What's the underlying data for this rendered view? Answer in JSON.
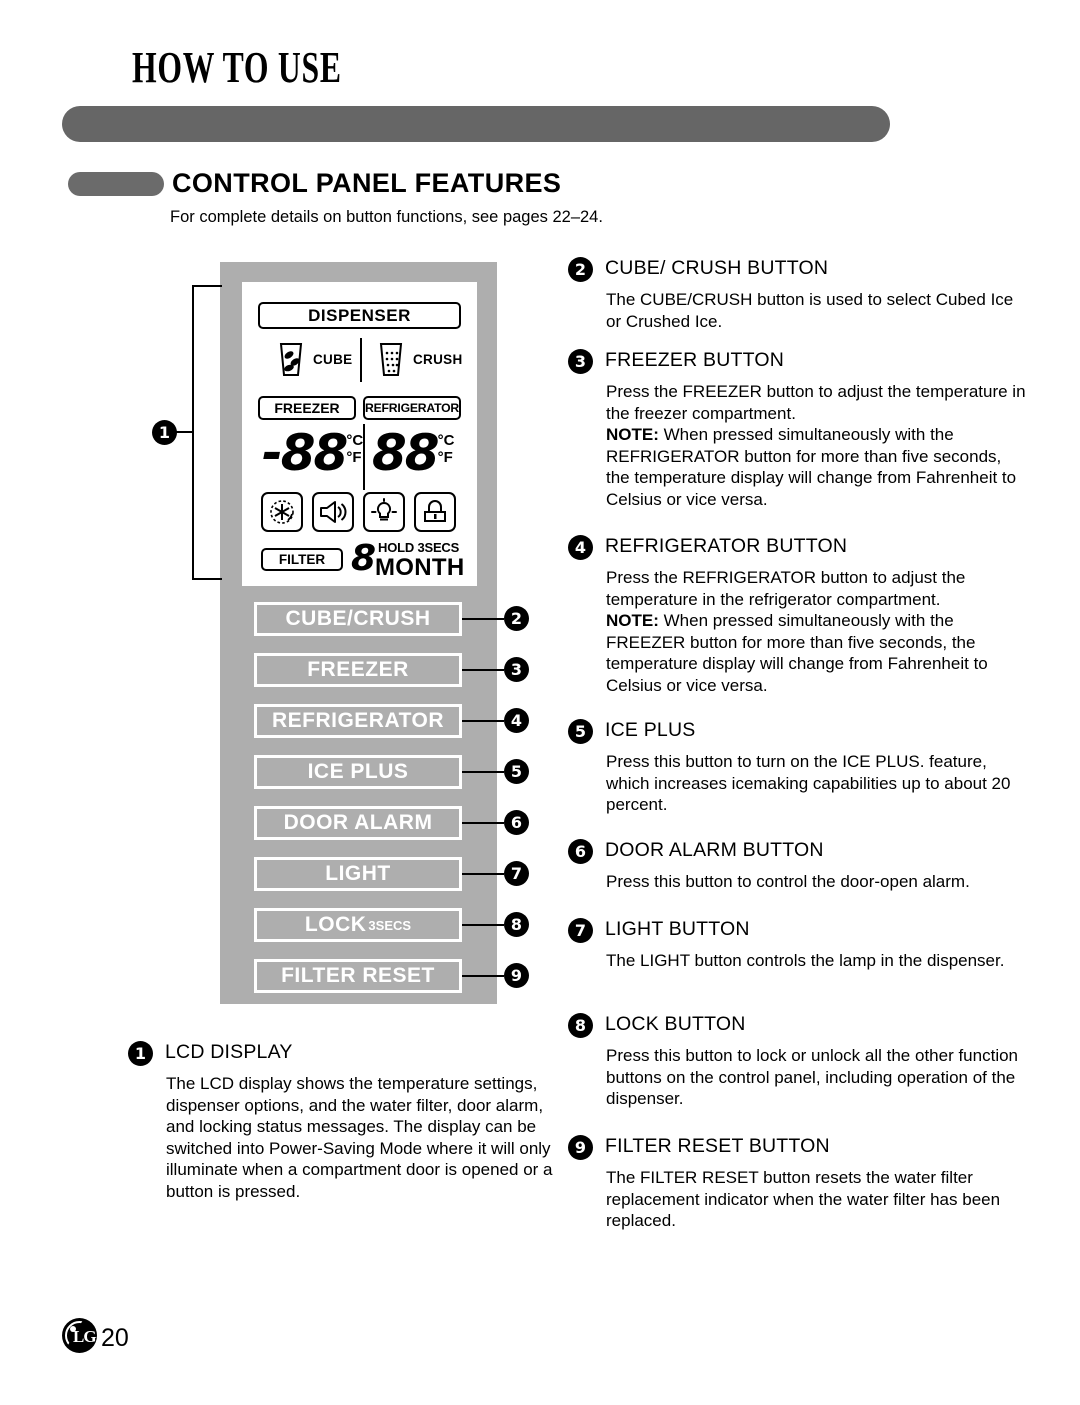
{
  "page": {
    "title": "HOW TO USE",
    "section_title": "CONTROL PANEL FEATURES",
    "section_subtitle": "For complete details on button functions, see pages 22–24.",
    "page_number": "20",
    "brand": "LG"
  },
  "lcd": {
    "dispenser_label": "DISPENSER",
    "cube_label": "CUBE",
    "crush_label": "CRUSH",
    "freezer_label": "FREEZER",
    "refrigerator_label": "REFRIGERATOR",
    "freezer_digits": "-88",
    "refrigerator_digits": "88",
    "unit_c": "°C",
    "unit_f": "°F",
    "filter_label": "FILTER",
    "month_digit": "8",
    "hold_secs": "HOLD 3SECS",
    "month_word": "MONTH",
    "icons": [
      "ice-plus-icon",
      "door-alarm-speaker-icon",
      "light-bulb-icon",
      "lock-icon"
    ]
  },
  "panel_buttons": [
    {
      "label": "CUBE/CRUSH",
      "callout": "2"
    },
    {
      "label": "FREEZER",
      "callout": "3"
    },
    {
      "label": "REFRIGERATOR",
      "callout": "4"
    },
    {
      "label": "ICE PLUS",
      "callout": "5"
    },
    {
      "label": "DOOR ALARM",
      "callout": "6"
    },
    {
      "label": "LIGHT",
      "callout": "7",
      "suffix": ""
    },
    {
      "label": "LOCK",
      "callout": "8",
      "suffix": "3SECS"
    },
    {
      "label": "FILTER RESET",
      "callout": "9"
    }
  ],
  "lcd_callout": "1",
  "entries": {
    "e1": {
      "num": "1",
      "head": "LCD DISPLAY",
      "body": "The LCD display shows the temperature settings, dispenser options, and the water filter, door alarm, and locking status messages. The display can be switched into Power-Saving Mode where it will only illuminate when a compartment door is opened or a button is pressed."
    },
    "e2": {
      "num": "2",
      "head": "CUBE/ CRUSH BUTTON",
      "body": "The CUBE/CRUSH button is used to select Cubed Ice or Crushed Ice."
    },
    "e3": {
      "num": "3",
      "head": "FREEZER BUTTON",
      "body_1": "Press the FREEZER button to adjust the temperature in the freezer compartment.",
      "note_label": "NOTE:",
      "body_2": " When pressed simultaneously with the REFRIGERATOR button for more than five seconds, the temperature display will change from Fahrenheit to Celsius or vice versa."
    },
    "e4": {
      "num": "4",
      "head": "REFRIGERATOR BUTTON",
      "body_1": "Press the REFRIGERATOR button to adjust the temperature in the refrigerator compartment.",
      "note_label": "NOTE:",
      "body_2": " When pressed simultaneously with the FREEZER button for more than five seconds, the temperature display will change from Fahrenheit to Celsius or vice versa."
    },
    "e5": {
      "num": "5",
      "head": "ICE PLUS",
      "body": "Press this button to turn on the ICE PLUS. feature, which increases icemaking capabilities up to about 20 percent."
    },
    "e6": {
      "num": "6",
      "head": "DOOR ALARM BUTTON",
      "body": "Press this button to control the door-open alarm."
    },
    "e7": {
      "num": "7",
      "head": "LIGHT BUTTON",
      "body": "The LIGHT button controls the lamp in the dispenser."
    },
    "e8": {
      "num": "8",
      "head": "LOCK BUTTON",
      "body": "Press this button to lock or unlock all the other function buttons on the control panel, including operation of the dispenser."
    },
    "e9": {
      "num": "9",
      "head": "FILTER RESET BUTTON",
      "body": "The FILTER RESET button resets the water filter replacement indicator when the water filter has been replaced."
    }
  },
  "colors": {
    "header_bar": "#666666",
    "panel_gray": "#aeaeae",
    "accent_black": "#000000"
  }
}
